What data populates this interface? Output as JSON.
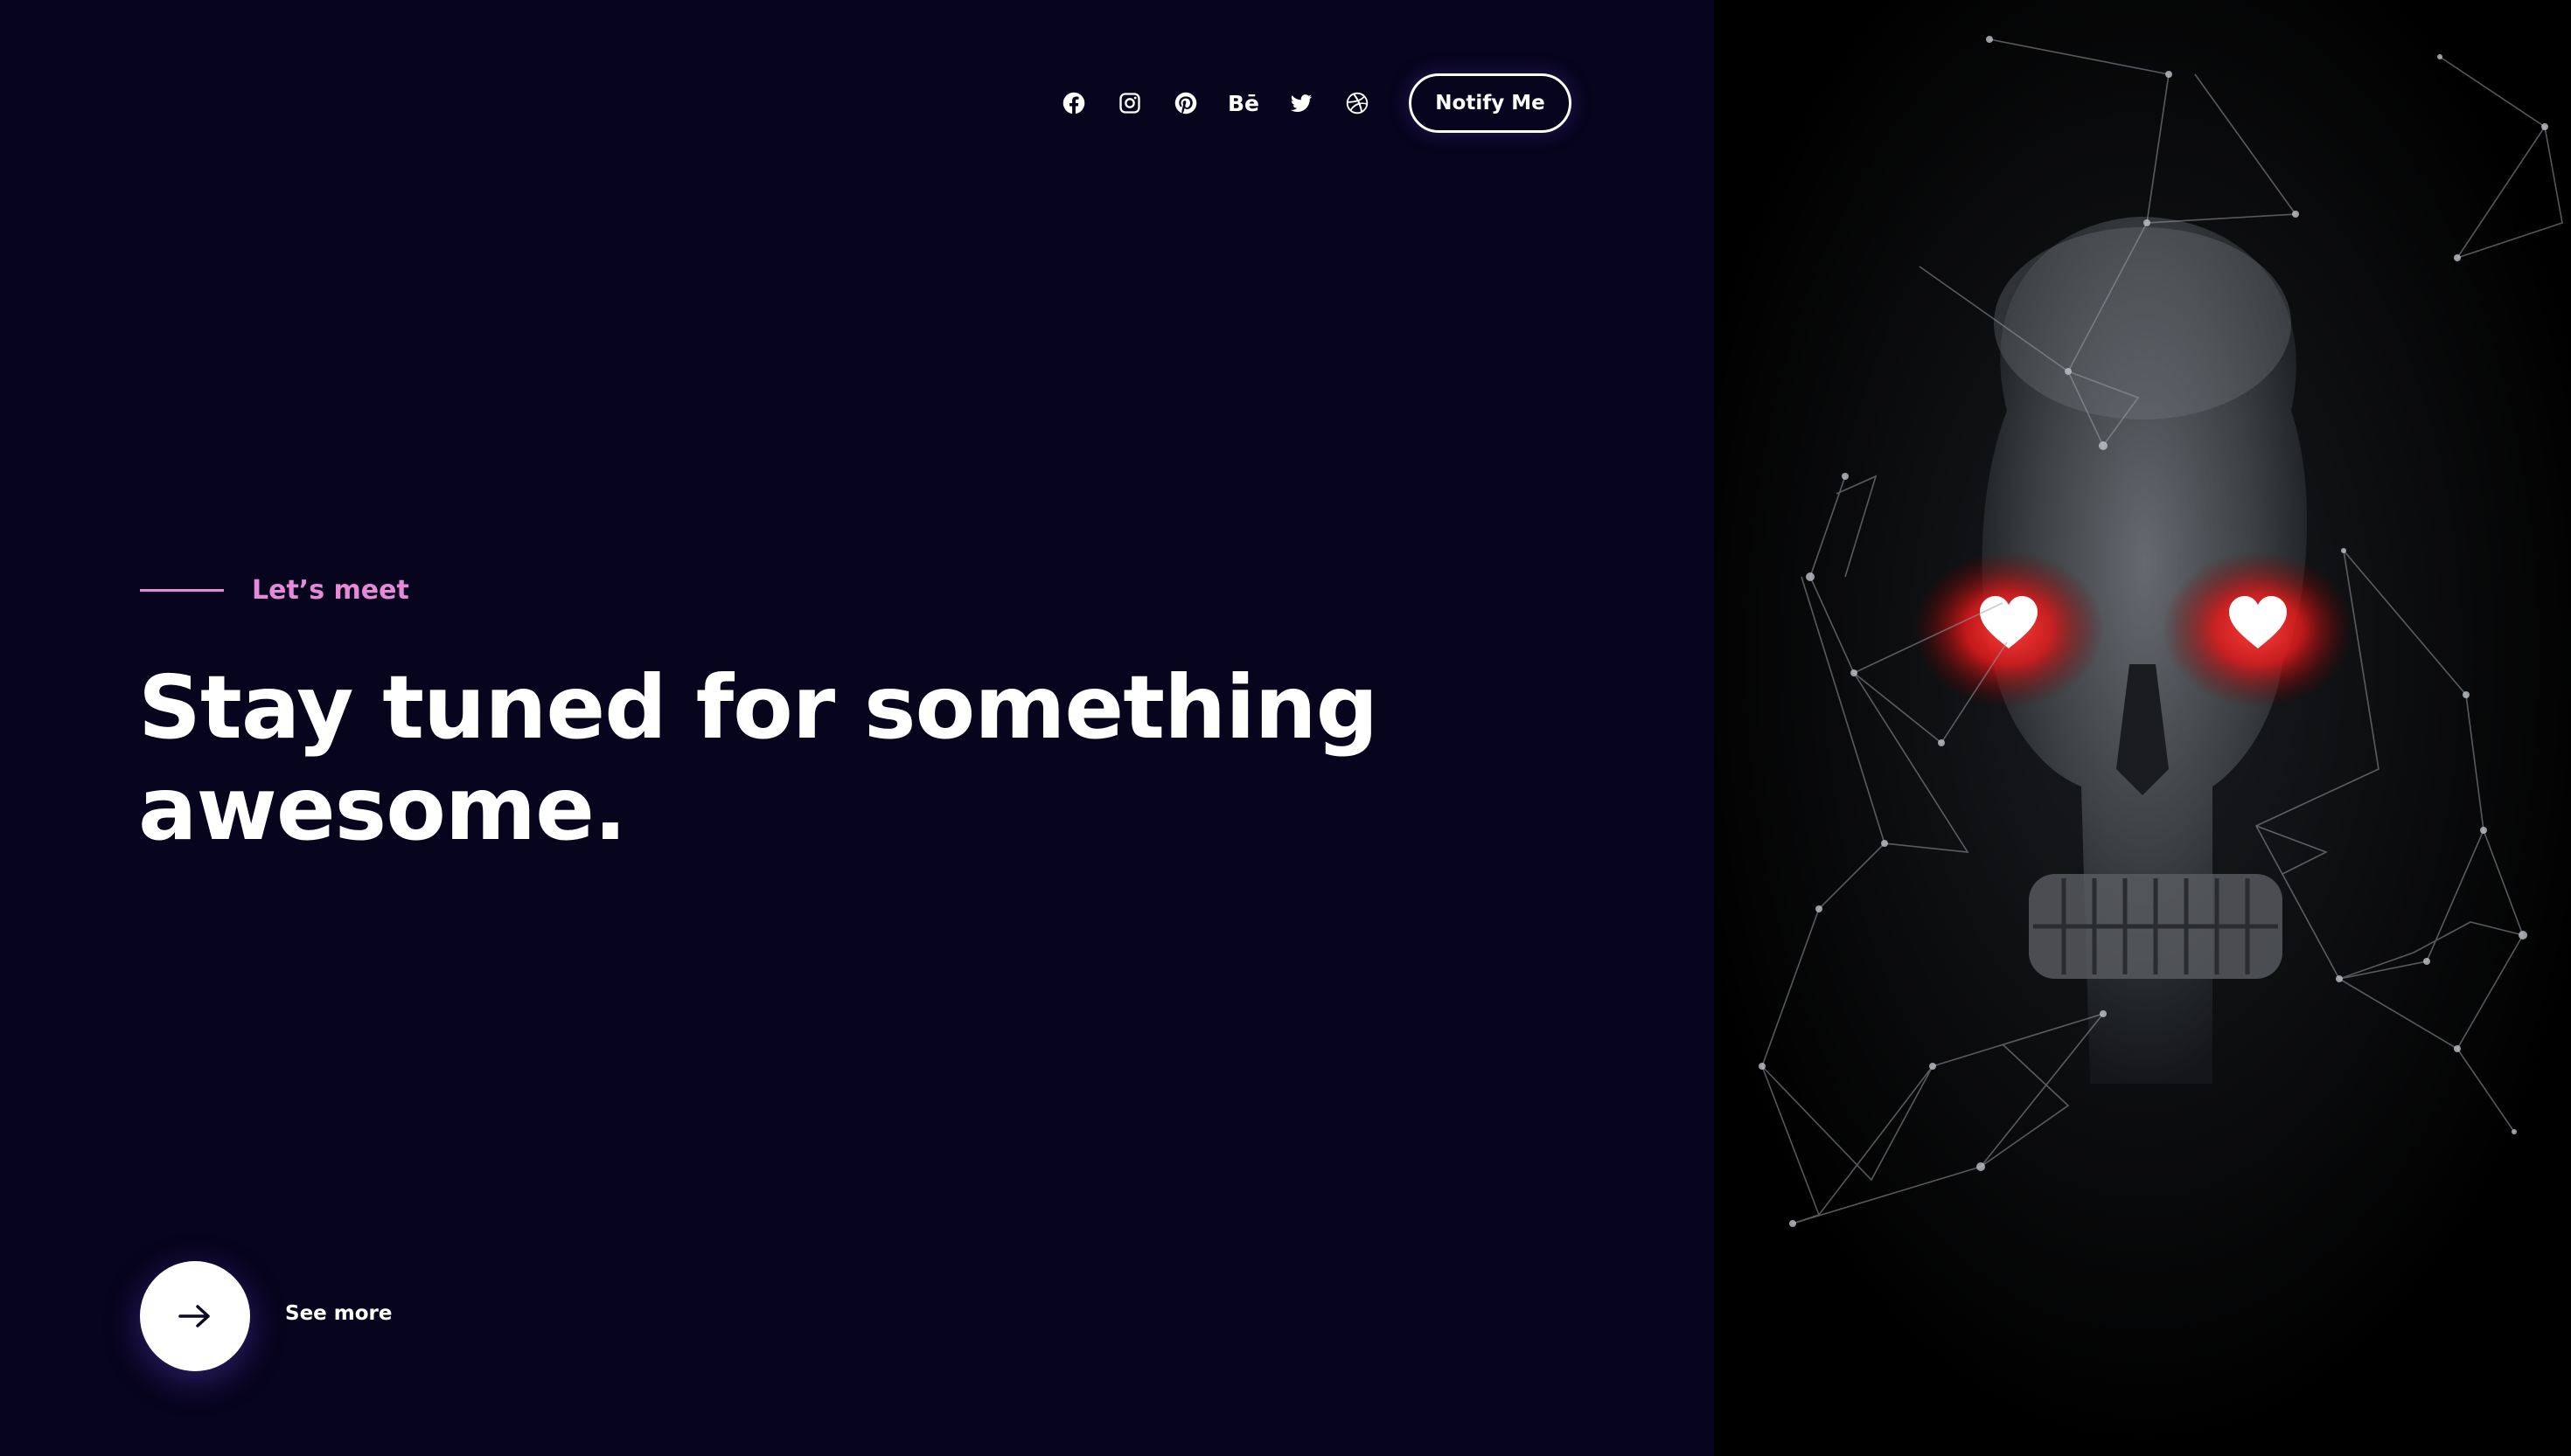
{
  "header": {
    "social_icons": [
      "facebook-icon",
      "instagram-icon",
      "pinterest-icon",
      "behance-icon",
      "twitter-icon",
      "dribbble-icon"
    ],
    "behance_label": "Bē",
    "notify_label": "Notify Me"
  },
  "hero": {
    "eyebrow": "Let’s meet",
    "headline_line1": "Stay tuned for something",
    "headline_line2": "awesome.",
    "see_more_label": "See more"
  },
  "colors": {
    "background": "#07041d",
    "accent": "#e58ad8",
    "text": "#ffffff",
    "eye_glow": "#ff2a2a"
  }
}
